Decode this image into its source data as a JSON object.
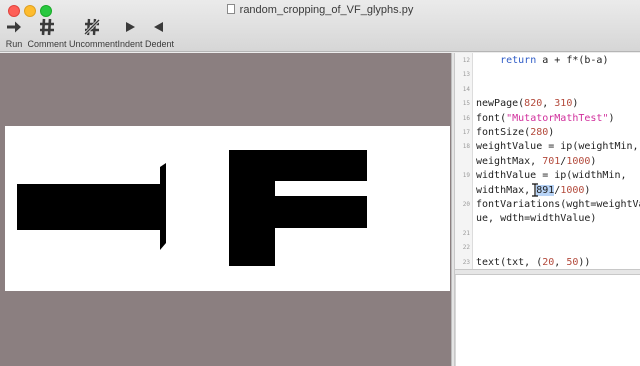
{
  "window": {
    "title": "random_cropping_of_VF_glyphs.py"
  },
  "toolbar": {
    "run_label": "Run",
    "comment_label": "Comment",
    "uncomment_label": "Uncomment",
    "indent_label": "Indent",
    "dedent_label": "Dedent",
    "run_icon": "play-arrow-icon",
    "comment_icon": "hash-icon",
    "uncomment_icon": "crossed-hash-icon",
    "indent_icon": "triangle-right-icon",
    "dedent_icon": "triangle-left-icon"
  },
  "code": {
    "lines": [
      {
        "num": "12",
        "parts": [
          [
            "plain",
            "    "
          ],
          [
            "kw",
            "return"
          ],
          [
            "plain",
            " a + f*(b-a)"
          ]
        ]
      },
      {
        "num": "13",
        "parts": []
      },
      {
        "num": "14",
        "parts": []
      },
      {
        "num": "15",
        "parts": [
          [
            "plain",
            "newPage("
          ],
          [
            "num",
            "820"
          ],
          [
            "plain",
            ", "
          ],
          [
            "num",
            "310"
          ],
          [
            "plain",
            ")"
          ]
        ]
      },
      {
        "num": "16",
        "parts": [
          [
            "plain",
            "font("
          ],
          [
            "str",
            "\"MutatorMathTest\""
          ],
          [
            "plain",
            ")"
          ]
        ]
      },
      {
        "num": "17",
        "parts": [
          [
            "plain",
            "fontSize("
          ],
          [
            "num",
            "280"
          ],
          [
            "plain",
            ")"
          ]
        ]
      },
      {
        "num": "18",
        "parts": [
          [
            "plain",
            "weightValue = ip(weightMin,"
          ]
        ]
      },
      {
        "num": "",
        "parts": [
          [
            "plain",
            "weightMax, "
          ],
          [
            "num",
            "701"
          ],
          [
            "plain",
            "/"
          ],
          [
            "num",
            "1000"
          ],
          [
            "plain",
            ")"
          ]
        ]
      },
      {
        "num": "19",
        "parts": [
          [
            "plain",
            "widthValue = ip(widthMin,"
          ]
        ]
      },
      {
        "num": "",
        "parts": [
          [
            "plain",
            "widthMax, "
          ],
          [
            "sel",
            "891"
          ],
          [
            "plain",
            "/"
          ],
          [
            "num",
            "1000"
          ],
          [
            "plain",
            ")"
          ]
        ]
      },
      {
        "num": "20",
        "parts": [
          [
            "plain",
            "fontVariations(wght=weightVal"
          ]
        ]
      },
      {
        "num": "",
        "parts": [
          [
            "plain",
            "ue, wdth=widthValue)"
          ]
        ]
      },
      {
        "num": "21",
        "parts": []
      },
      {
        "num": "22",
        "parts": []
      },
      {
        "num": "23",
        "parts": [
          [
            "plain",
            "text(txt, ("
          ],
          [
            "num",
            "20"
          ],
          [
            "plain",
            ", "
          ],
          [
            "num",
            "50"
          ],
          [
            "plain",
            "))"
          ]
        ]
      }
    ]
  },
  "colors": {
    "canvas_background": "#8b7f80",
    "page_background": "#ffffff",
    "glyph_fill": "#000000",
    "keyword": "#2f5cc7",
    "string": "#d12f9c",
    "number": "#b34a3c",
    "selection": "#b8d4f7"
  }
}
